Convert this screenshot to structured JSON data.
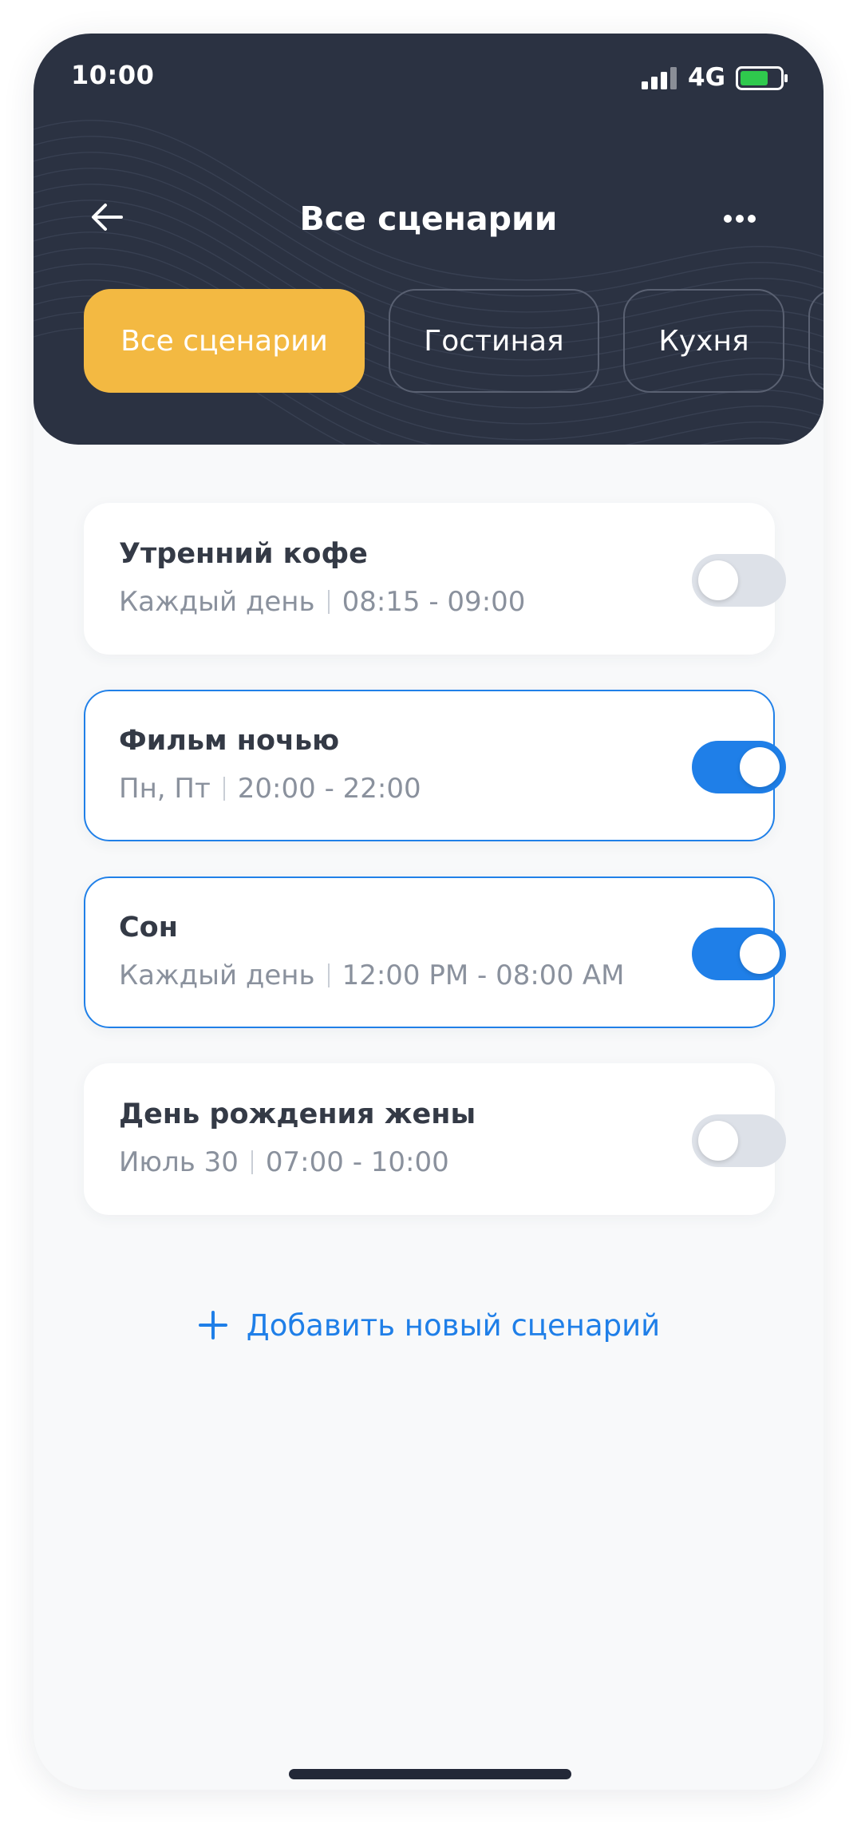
{
  "status_bar": {
    "time": "10:00",
    "network": "4G",
    "battery_color": "#2fc94d"
  },
  "header": {
    "title": "Все сценарии",
    "back_icon": "arrow-left-icon",
    "more_icon": "more-horizontal-icon",
    "background_color": "#2b3242"
  },
  "tabs": [
    {
      "label": "Все сценарии",
      "active": true
    },
    {
      "label": "Гостиная",
      "active": false
    },
    {
      "label": "Кухня",
      "active": false
    },
    {
      "label": "",
      "active": false
    }
  ],
  "scenarios": [
    {
      "title": "Утренний кофе",
      "days": "Каждый день",
      "time": "08:15 - 09:00",
      "enabled": false
    },
    {
      "title": "Фильм ночью",
      "days": "Пн, Пт",
      "time": "20:00 - 22:00",
      "enabled": true
    },
    {
      "title": "Сон",
      "days": "Каждый день",
      "time": "12:00 PM - 08:00 AM",
      "enabled": true
    },
    {
      "title": "День рождения жены",
      "days": "Июль 30",
      "time": "07:00 - 10:00",
      "enabled": false
    }
  ],
  "add_scenario": {
    "label": "Добавить новый сценарий",
    "icon": "plus-icon"
  },
  "colors": {
    "accent_blue": "#1f7fe8",
    "active_tab": "#f3b942"
  }
}
